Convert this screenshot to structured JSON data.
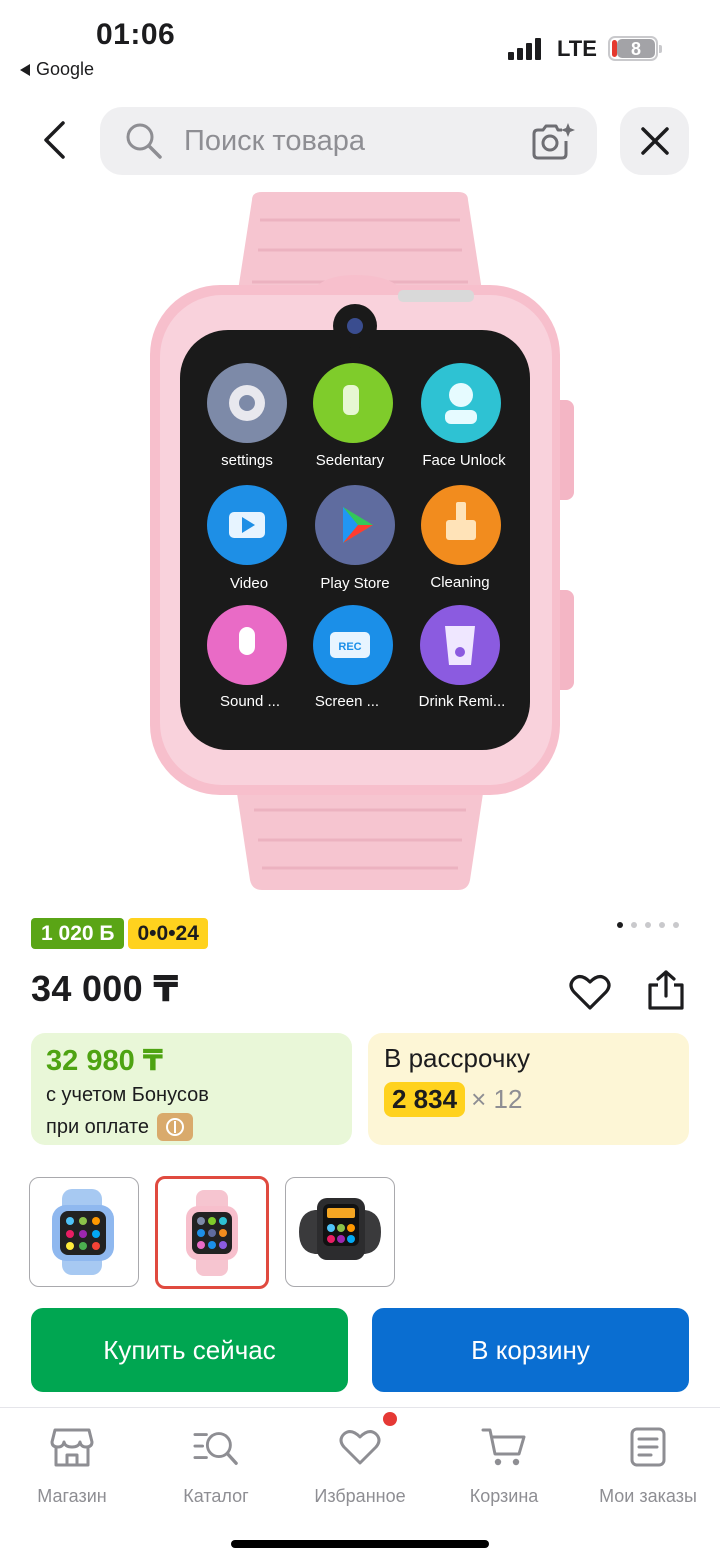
{
  "status_bar": {
    "time": "01:06",
    "back_app": "Google",
    "network": "LTE",
    "battery_level": "8"
  },
  "header": {
    "search_placeholder": "Поиск товара"
  },
  "product": {
    "bonus_badge": "1 020 Б",
    "installment_badge": "0•0•24",
    "image_pager": {
      "count": 5,
      "active": 1
    },
    "price": "34 000 ₸"
  },
  "bonus_card": {
    "amount": "32 980 ₸",
    "line1": "с учетом Бонусов",
    "line2": "при оплате"
  },
  "installment_card": {
    "title": "В рассрочку",
    "monthly": "2 834",
    "months": "× 12"
  },
  "thumbnails": [
    {
      "color": "blue",
      "selected": false
    },
    {
      "color": "pink",
      "selected": true
    },
    {
      "color": "black",
      "selected": false
    }
  ],
  "actions": {
    "buy_now": "Купить сейчас",
    "add_to_cart": "В корзину"
  },
  "tabbar": {
    "items": [
      {
        "label": "Магазин",
        "icon": "store-icon"
      },
      {
        "label": "Каталог",
        "icon": "catalog-search-icon"
      },
      {
        "label": "Избранное",
        "icon": "heart-icon",
        "has_notification": true
      },
      {
        "label": "Корзина",
        "icon": "cart-icon"
      },
      {
        "label": "Мои заказы",
        "icon": "orders-icon"
      }
    ]
  },
  "watch_screen_apps": [
    "settings",
    "Sedentary",
    "Face Unlock",
    "Video",
    "Play Store",
    "Cleaning",
    "Sound ...",
    "Screen ...",
    "Drink Remi..."
  ],
  "colors": {
    "buy_button": "#00a651",
    "cart_button": "#0a6ed1",
    "bonus_green": "#5aa516",
    "installment_yellow": "#ffd21e",
    "selected_thumb_border": "#e04a3f"
  }
}
